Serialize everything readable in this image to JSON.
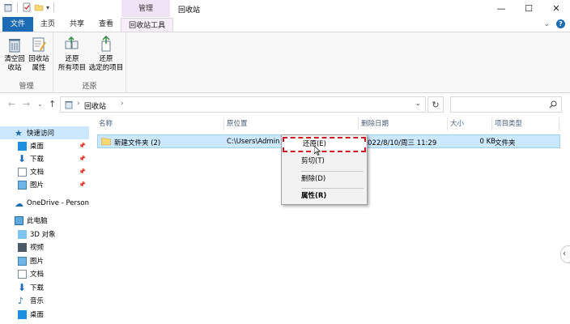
{
  "window": {
    "title": "回收站",
    "context_tab_header": "管理",
    "controls": {
      "minimize": "—",
      "maximize": "☐",
      "close": "✕"
    }
  },
  "ribbon": {
    "tabs": [
      {
        "label": "文件"
      },
      {
        "label": "主页"
      },
      {
        "label": "共享"
      },
      {
        "label": "查看"
      },
      {
        "label": "回收站工具"
      }
    ],
    "groups": {
      "manage": {
        "name": "管理",
        "empty_line1": "清空回",
        "empty_line2": "收站",
        "props_line1": "回收站",
        "props_line2": "属性"
      },
      "restore": {
        "name": "还原",
        "all_line1": "还原",
        "all_line2": "所有项目",
        "sel_line1": "还原",
        "sel_line2": "选定的项目"
      }
    }
  },
  "address": {
    "breadcrumb": "回收站",
    "sep": "›",
    "search_placeholder": ""
  },
  "nav": {
    "items": [
      {
        "label": "快速访问",
        "pin": ""
      },
      {
        "label": "桌面",
        "pin": "📌"
      },
      {
        "label": "下载",
        "pin": "📌"
      },
      {
        "label": "文档",
        "pin": "📌"
      },
      {
        "label": "图片",
        "pin": "📌"
      },
      {
        "label": "OneDrive - Persona",
        "pin": ""
      },
      {
        "label": "此电脑",
        "pin": ""
      },
      {
        "label": "3D 对象",
        "pin": ""
      },
      {
        "label": "视频",
        "pin": ""
      },
      {
        "label": "图片",
        "pin": ""
      },
      {
        "label": "文档",
        "pin": ""
      },
      {
        "label": "下载",
        "pin": ""
      },
      {
        "label": "音乐",
        "pin": ""
      },
      {
        "label": "桌面",
        "pin": ""
      }
    ]
  },
  "columns": {
    "name": "名称",
    "orig": "原位置",
    "date": "删除日期",
    "size": "大小",
    "type": "项目类型"
  },
  "files": [
    {
      "name": "新建文件夹 (2)",
      "orig": "C:\\Users\\Admini",
      "date": "022/8/10/周三 11:29",
      "size": "0 KB",
      "type": "文件夹"
    }
  ],
  "context_menu": {
    "restore": "还原(E)",
    "cut": "剪切(T)",
    "delete": "删除(D)",
    "properties": "属性(R)"
  },
  "colors": {
    "file_tab": "#1b6bb5",
    "selection": "#cce8ff",
    "highlight_border": "#d0161f",
    "context_tab": "#f1e3f6"
  }
}
